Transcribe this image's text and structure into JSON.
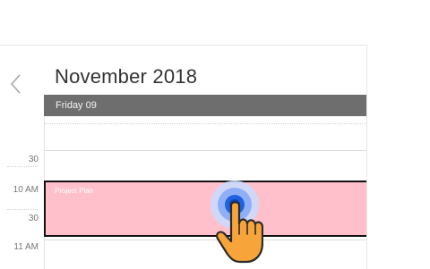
{
  "calendar": {
    "month_title": "November 2018",
    "day_header": "Friday 09",
    "time_labels": [
      "30",
      "10 AM",
      "30",
      "11 AM"
    ],
    "appointment": {
      "subject": "Project Plan",
      "color": "#ffc0cb"
    }
  },
  "icons": {
    "back": "chevron-left-icon",
    "gesture": "tap-hand-icon"
  }
}
